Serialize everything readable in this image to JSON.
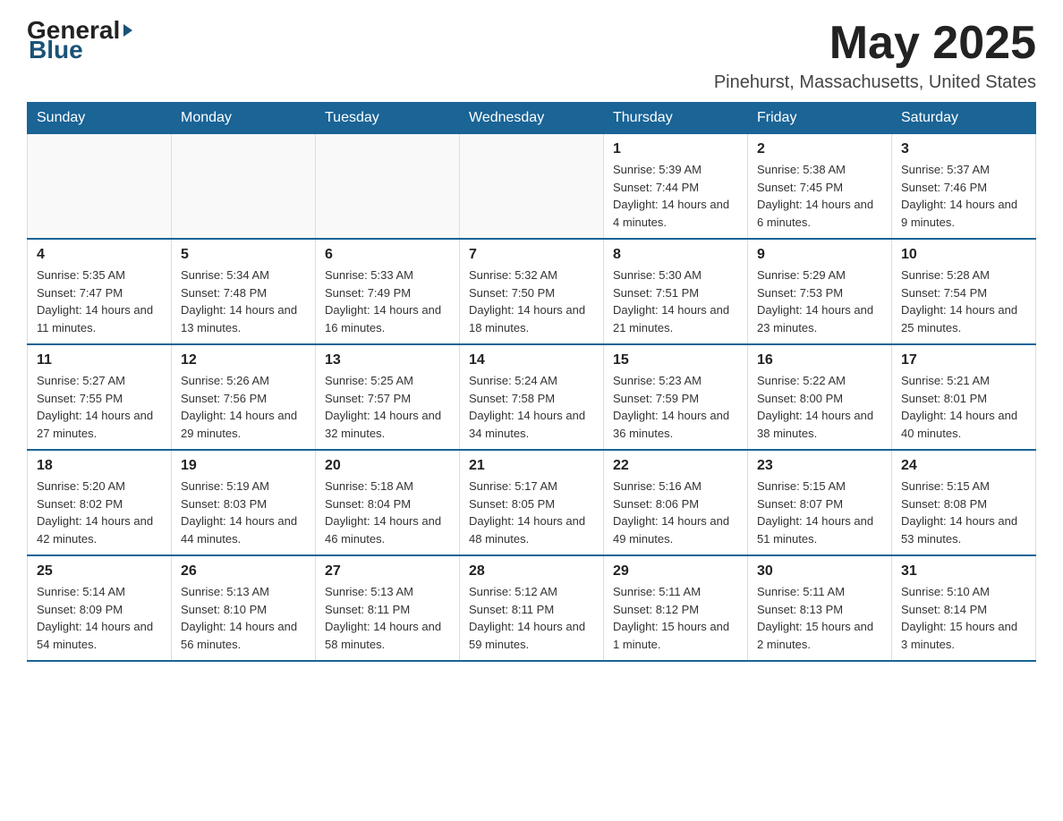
{
  "header": {
    "logo": {
      "general": "General",
      "blue": "Blue"
    },
    "title": "May 2025",
    "location": "Pinehurst, Massachusetts, United States"
  },
  "days_of_week": [
    "Sunday",
    "Monday",
    "Tuesday",
    "Wednesday",
    "Thursday",
    "Friday",
    "Saturday"
  ],
  "weeks": [
    [
      {
        "day": "",
        "info": ""
      },
      {
        "day": "",
        "info": ""
      },
      {
        "day": "",
        "info": ""
      },
      {
        "day": "",
        "info": ""
      },
      {
        "day": "1",
        "info": "Sunrise: 5:39 AM\nSunset: 7:44 PM\nDaylight: 14 hours and 4 minutes."
      },
      {
        "day": "2",
        "info": "Sunrise: 5:38 AM\nSunset: 7:45 PM\nDaylight: 14 hours and 6 minutes."
      },
      {
        "day": "3",
        "info": "Sunrise: 5:37 AM\nSunset: 7:46 PM\nDaylight: 14 hours and 9 minutes."
      }
    ],
    [
      {
        "day": "4",
        "info": "Sunrise: 5:35 AM\nSunset: 7:47 PM\nDaylight: 14 hours and 11 minutes."
      },
      {
        "day": "5",
        "info": "Sunrise: 5:34 AM\nSunset: 7:48 PM\nDaylight: 14 hours and 13 minutes."
      },
      {
        "day": "6",
        "info": "Sunrise: 5:33 AM\nSunset: 7:49 PM\nDaylight: 14 hours and 16 minutes."
      },
      {
        "day": "7",
        "info": "Sunrise: 5:32 AM\nSunset: 7:50 PM\nDaylight: 14 hours and 18 minutes."
      },
      {
        "day": "8",
        "info": "Sunrise: 5:30 AM\nSunset: 7:51 PM\nDaylight: 14 hours and 21 minutes."
      },
      {
        "day": "9",
        "info": "Sunrise: 5:29 AM\nSunset: 7:53 PM\nDaylight: 14 hours and 23 minutes."
      },
      {
        "day": "10",
        "info": "Sunrise: 5:28 AM\nSunset: 7:54 PM\nDaylight: 14 hours and 25 minutes."
      }
    ],
    [
      {
        "day": "11",
        "info": "Sunrise: 5:27 AM\nSunset: 7:55 PM\nDaylight: 14 hours and 27 minutes."
      },
      {
        "day": "12",
        "info": "Sunrise: 5:26 AM\nSunset: 7:56 PM\nDaylight: 14 hours and 29 minutes."
      },
      {
        "day": "13",
        "info": "Sunrise: 5:25 AM\nSunset: 7:57 PM\nDaylight: 14 hours and 32 minutes."
      },
      {
        "day": "14",
        "info": "Sunrise: 5:24 AM\nSunset: 7:58 PM\nDaylight: 14 hours and 34 minutes."
      },
      {
        "day": "15",
        "info": "Sunrise: 5:23 AM\nSunset: 7:59 PM\nDaylight: 14 hours and 36 minutes."
      },
      {
        "day": "16",
        "info": "Sunrise: 5:22 AM\nSunset: 8:00 PM\nDaylight: 14 hours and 38 minutes."
      },
      {
        "day": "17",
        "info": "Sunrise: 5:21 AM\nSunset: 8:01 PM\nDaylight: 14 hours and 40 minutes."
      }
    ],
    [
      {
        "day": "18",
        "info": "Sunrise: 5:20 AM\nSunset: 8:02 PM\nDaylight: 14 hours and 42 minutes."
      },
      {
        "day": "19",
        "info": "Sunrise: 5:19 AM\nSunset: 8:03 PM\nDaylight: 14 hours and 44 minutes."
      },
      {
        "day": "20",
        "info": "Sunrise: 5:18 AM\nSunset: 8:04 PM\nDaylight: 14 hours and 46 minutes."
      },
      {
        "day": "21",
        "info": "Sunrise: 5:17 AM\nSunset: 8:05 PM\nDaylight: 14 hours and 48 minutes."
      },
      {
        "day": "22",
        "info": "Sunrise: 5:16 AM\nSunset: 8:06 PM\nDaylight: 14 hours and 49 minutes."
      },
      {
        "day": "23",
        "info": "Sunrise: 5:15 AM\nSunset: 8:07 PM\nDaylight: 14 hours and 51 minutes."
      },
      {
        "day": "24",
        "info": "Sunrise: 5:15 AM\nSunset: 8:08 PM\nDaylight: 14 hours and 53 minutes."
      }
    ],
    [
      {
        "day": "25",
        "info": "Sunrise: 5:14 AM\nSunset: 8:09 PM\nDaylight: 14 hours and 54 minutes."
      },
      {
        "day": "26",
        "info": "Sunrise: 5:13 AM\nSunset: 8:10 PM\nDaylight: 14 hours and 56 minutes."
      },
      {
        "day": "27",
        "info": "Sunrise: 5:13 AM\nSunset: 8:11 PM\nDaylight: 14 hours and 58 minutes."
      },
      {
        "day": "28",
        "info": "Sunrise: 5:12 AM\nSunset: 8:11 PM\nDaylight: 14 hours and 59 minutes."
      },
      {
        "day": "29",
        "info": "Sunrise: 5:11 AM\nSunset: 8:12 PM\nDaylight: 15 hours and 1 minute."
      },
      {
        "day": "30",
        "info": "Sunrise: 5:11 AM\nSunset: 8:13 PM\nDaylight: 15 hours and 2 minutes."
      },
      {
        "day": "31",
        "info": "Sunrise: 5:10 AM\nSunset: 8:14 PM\nDaylight: 15 hours and 3 minutes."
      }
    ]
  ]
}
